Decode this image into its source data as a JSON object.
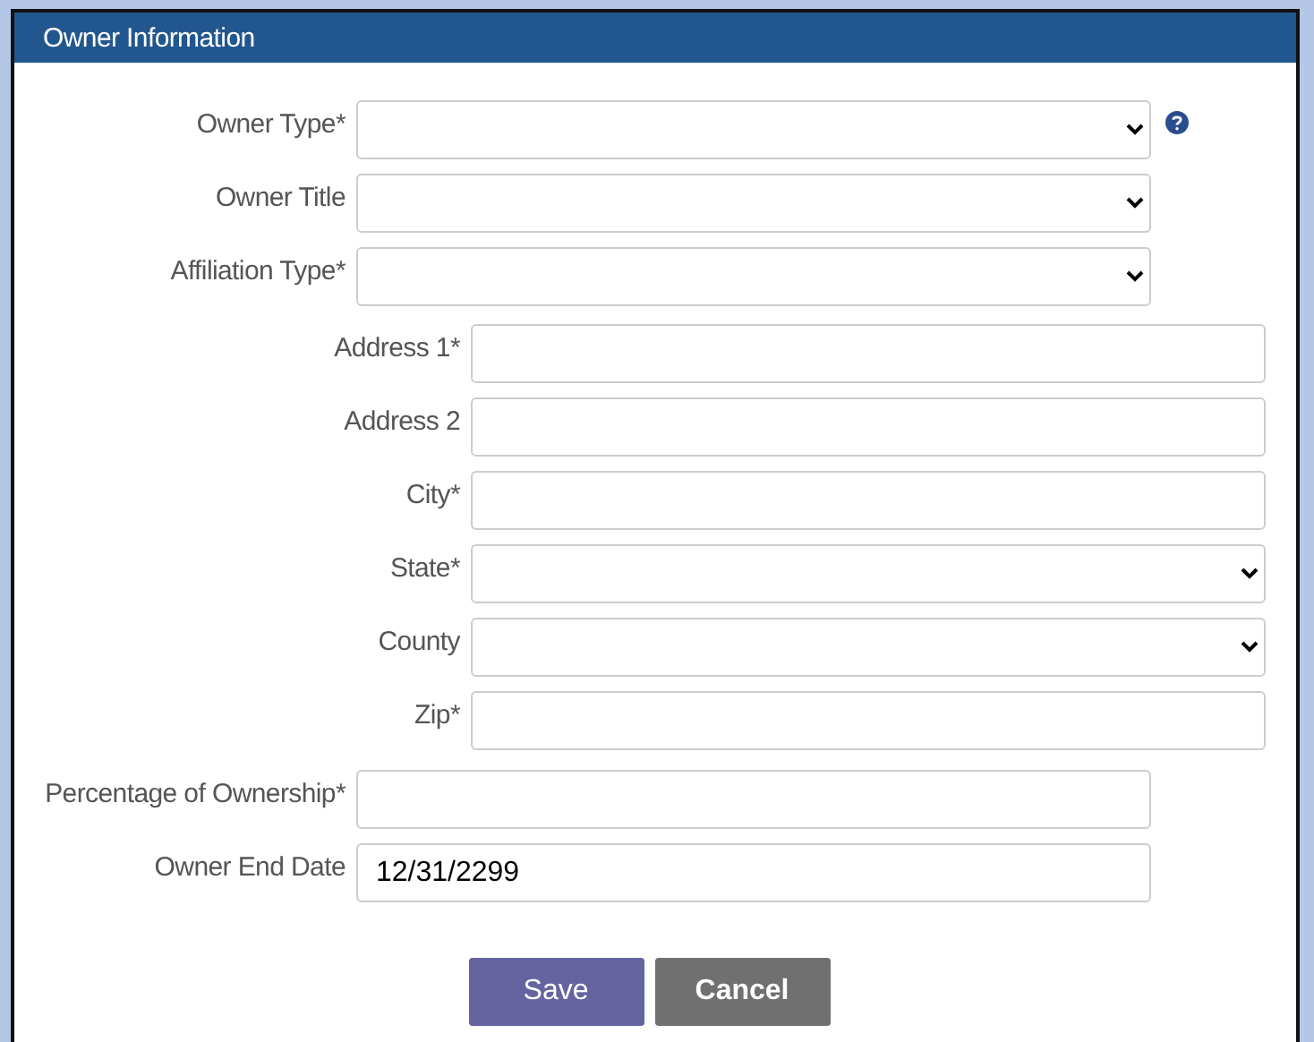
{
  "panel": {
    "title": "Owner Information"
  },
  "groups": [
    {
      "fields": [
        {
          "label": "Owner Type*",
          "kind": "select",
          "help": true
        },
        {
          "label": "Owner Title",
          "kind": "select"
        },
        {
          "label": "Affiliation Type*",
          "kind": "select"
        }
      ]
    },
    {
      "fields": [
        {
          "label": "Address 1*",
          "kind": "text"
        },
        {
          "label": "Address 2",
          "kind": "text"
        },
        {
          "label": "City*",
          "kind": "text"
        },
        {
          "label": "State*",
          "kind": "select"
        },
        {
          "label": "County",
          "kind": "select"
        },
        {
          "label": "Zip*",
          "kind": "text"
        }
      ]
    },
    {
      "fields": [
        {
          "label": "Percentage of Ownership*",
          "kind": "text"
        },
        {
          "label": "Owner End Date",
          "kind": "text",
          "value": "12/31/2299"
        }
      ]
    }
  ],
  "buttons": [
    {
      "label": "Save",
      "kind": "primary"
    },
    {
      "label": "Cancel",
      "kind": "secondary"
    }
  ]
}
